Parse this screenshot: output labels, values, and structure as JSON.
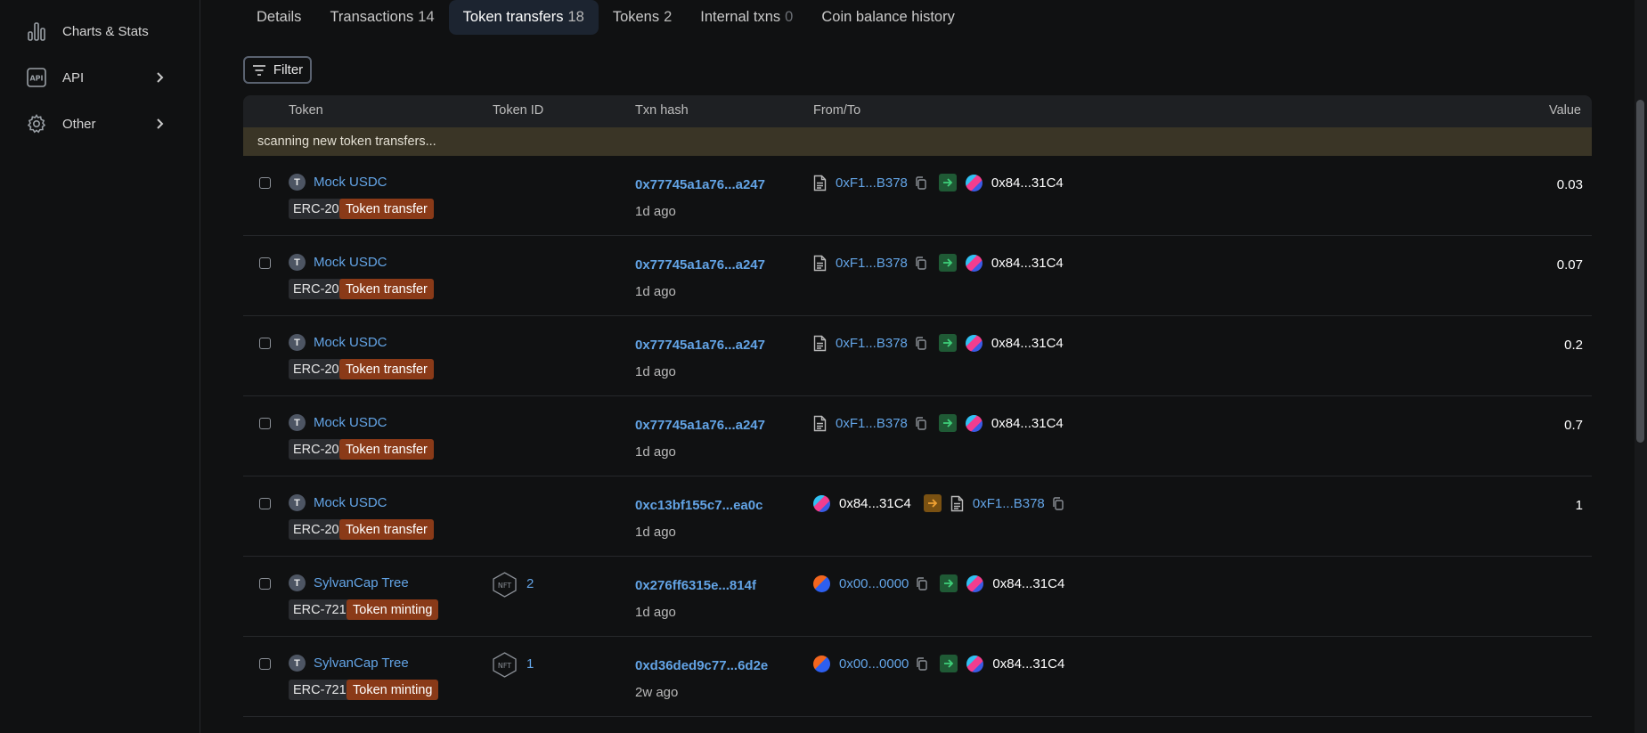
{
  "sidebar": {
    "items": [
      {
        "label": "Charts & Stats",
        "icon": "chart-icon"
      },
      {
        "label": "API",
        "icon": "api-icon"
      },
      {
        "label": "Other",
        "icon": "gear-icon"
      }
    ]
  },
  "tabs": [
    {
      "label": "Details",
      "count": ""
    },
    {
      "label": "Transactions",
      "count": "14"
    },
    {
      "label": "Token transfers",
      "count": "18"
    },
    {
      "label": "Tokens",
      "count": "2"
    },
    {
      "label": "Internal txns",
      "count": "0"
    },
    {
      "label": "Coin balance history",
      "count": ""
    }
  ],
  "active_tab": "Token transfers",
  "filter": {
    "label": "Filter"
  },
  "table": {
    "headers": {
      "token": "Token",
      "token_id": "Token ID",
      "txn_hash": "Txn hash",
      "from_to": "From/To",
      "value": "Value"
    },
    "scanning": "scanning new token transfers...",
    "rows": [
      {
        "token_letter": "T",
        "token": "Mock USDC",
        "standard": "ERC-20",
        "type": "Token transfer",
        "token_id": "",
        "hash": "0x77745a1a76...a247",
        "age": "1d ago",
        "from": "0xF1...B378",
        "to": "0x84...31C4",
        "direction": "out",
        "value": "0.03"
      },
      {
        "token_letter": "T",
        "token": "Mock USDC",
        "standard": "ERC-20",
        "type": "Token transfer",
        "token_id": "",
        "hash": "0x77745a1a76...a247",
        "age": "1d ago",
        "from": "0xF1...B378",
        "to": "0x84...31C4",
        "direction": "out",
        "value": "0.07"
      },
      {
        "token_letter": "T",
        "token": "Mock USDC",
        "standard": "ERC-20",
        "type": "Token transfer",
        "token_id": "",
        "hash": "0x77745a1a76...a247",
        "age": "1d ago",
        "from": "0xF1...B378",
        "to": "0x84...31C4",
        "direction": "out",
        "value": "0.2"
      },
      {
        "token_letter": "T",
        "token": "Mock USDC",
        "standard": "ERC-20",
        "type": "Token transfer",
        "token_id": "",
        "hash": "0x77745a1a76...a247",
        "age": "1d ago",
        "from": "0xF1...B378",
        "to": "0x84...31C4",
        "direction": "out",
        "value": "0.7"
      },
      {
        "token_letter": "T",
        "token": "Mock USDC",
        "standard": "ERC-20",
        "type": "Token transfer",
        "token_id": "",
        "hash": "0xc13bf155c7...ea0c",
        "age": "1d ago",
        "from": "0x84...31C4",
        "to": "0xF1...B378",
        "direction": "in",
        "value": "1"
      },
      {
        "token_letter": "T",
        "token": "SylvanCap Tree",
        "standard": "ERC-721",
        "type": "Token minting",
        "token_id": "2",
        "hash": "0x276ff6315e...814f",
        "age": "1d ago",
        "from": "0x00...0000",
        "to": "0x84...31C4",
        "direction": "out",
        "value": ""
      },
      {
        "token_letter": "T",
        "token": "SylvanCap Tree",
        "standard": "ERC-721",
        "type": "Token minting",
        "token_id": "1",
        "hash": "0xd36ded9c77...6d2e",
        "age": "2w ago",
        "from": "0x00...0000",
        "to": "0x84...31C4",
        "direction": "out",
        "value": ""
      }
    ]
  },
  "colors": {
    "link": "#63a4e6",
    "badge_transfer": "#8a3a18",
    "active_tab_bg": "#1c2430",
    "scan_bg": "#3a3526",
    "out_arrow": "#1f5a35",
    "in_arrow": "#7a5112"
  }
}
